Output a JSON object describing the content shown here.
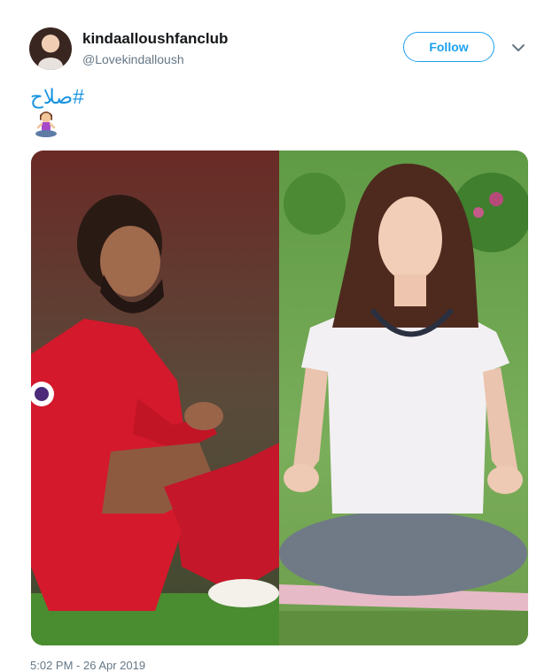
{
  "tweet": {
    "display_name": "kindaalloushfanclub",
    "handle": "@Lovekindalloush",
    "follow_label": "Follow",
    "hashtag": "#صلاح",
    "timestamp": "5:02 PM - 26 Apr 2019"
  },
  "colors": {
    "accent": "#1da1f2",
    "link": "#1b95e0",
    "secondary_text": "#657786",
    "primary_text": "#14171a"
  },
  "icons": {
    "menu": "chevron-down-icon",
    "emoji": "person-in-lotus-position-emoji"
  }
}
